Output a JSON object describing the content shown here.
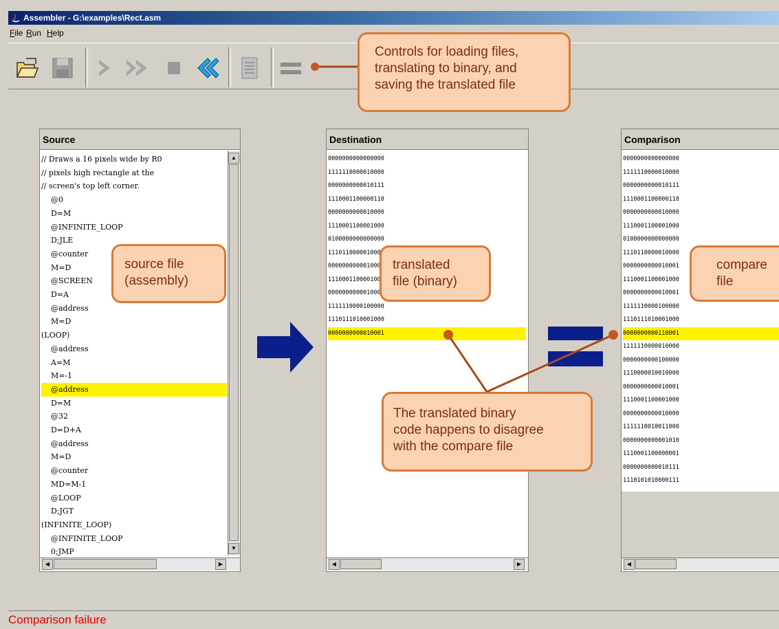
{
  "window": {
    "title": "Assembler - G:\\examples\\Rect.asm"
  },
  "menu": {
    "items": [
      "File",
      "Run",
      "Help"
    ]
  },
  "toolbar": {
    "buttons": [
      "load-file",
      "save-file",
      "single-step",
      "fast-forward",
      "stop",
      "rewind",
      "load-compare-file",
      "compare"
    ]
  },
  "callouts": {
    "controls": [
      "Controls for loading files,",
      "translating to binary, and",
      "saving the translated file"
    ],
    "source": [
      "source file",
      "(assembly)"
    ],
    "translated": [
      "translated",
      "file (binary)"
    ],
    "compare": [
      "compare",
      "file"
    ],
    "disagree": [
      "The translated binary",
      "code happens to disagree",
      "with the compare file"
    ]
  },
  "source": {
    "header": "Source",
    "lines": [
      "// Draws a 16 pixels wide by R0",
      "// pixels high rectangle at the",
      "// screen's top left corner.",
      "    @0",
      "    D=M",
      "    @INFINITE_LOOP",
      "    D;JLE",
      "    @counter",
      "    M=D",
      "    @SCREEN",
      "    D=A",
      "    @address",
      "    M=D",
      "(LOOP)",
      "    @address",
      "    A=M",
      "    M=-1",
      "    @address",
      "    D=M",
      "    @32",
      "    D=D+A",
      "    @address",
      "    M=D",
      "    @counter",
      "    MD=M-1",
      "    @LOOP",
      "    D;JGT",
      "(INFINITE_LOOP)",
      "    @INFINITE_LOOP",
      "    0;JMP"
    ],
    "highlight_index": 17
  },
  "destination": {
    "header": "Destination",
    "lines": [
      "0000000000000000",
      "1111110000010000",
      "0000000000010111",
      "1110001100000110",
      "0000000000010000",
      "1110001100001000",
      "0100000000000000",
      "1110110000010000",
      "0000000000010001",
      "1110001100001000",
      "0000000000010001",
      "1111110000100000",
      "1110111010001000",
      "0000000000010001"
    ],
    "highlight_index": 13
  },
  "comparison": {
    "header": "Comparison",
    "lines": [
      "0000000000000000",
      "1111110000010000",
      "0000000000010111",
      "1110001100000110",
      "0000000000010000",
      "1110001100001000",
      "0100000000000000",
      "1110110000010000",
      "0000000000010001",
      "1110001100001000",
      "0000000000010001",
      "1111110000100000",
      "1110111010001000",
      "0000000000110001",
      "1111110000010000",
      "0000000000100000",
      "1110000010010000",
      "0000000000010001",
      "1110001100001000",
      "0000000000010000",
      "1111110010011000",
      "0000000000001010",
      "1110001100000001",
      "0000000000010111",
      "1110101010000111"
    ],
    "highlight_index": 13
  },
  "status": {
    "text": "Comparison failure"
  },
  "colors": {
    "highlight": "#fff200",
    "callout_fill": "#fbd3b2",
    "callout_border": "#d97a35",
    "arrow": "#0b1f8a",
    "status": "#e00000"
  }
}
